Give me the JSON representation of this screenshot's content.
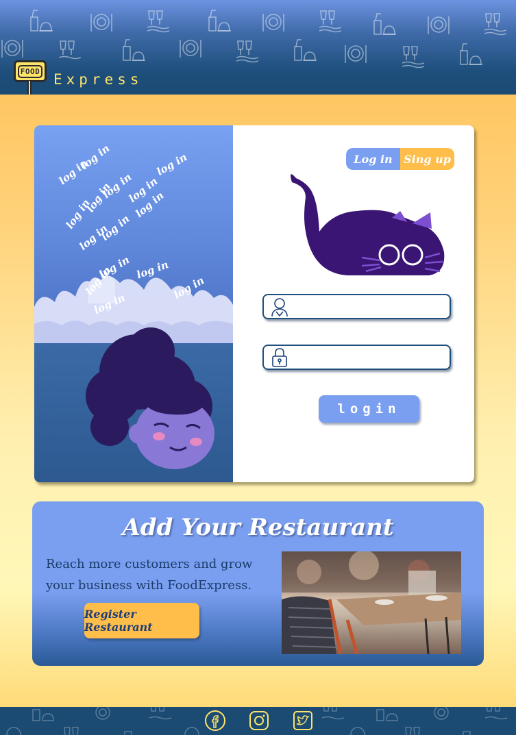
{
  "header": {
    "logo_sign": "FOOD",
    "brand": "Express",
    "accent": "#ffe46a",
    "background": "#1e4f7c"
  },
  "login": {
    "illustration_words": "log in",
    "tabs": [
      {
        "label": "Log in",
        "color": "#7b9ff0",
        "active": true
      },
      {
        "label": "Sing up",
        "color": "#ffbd4a",
        "active": false
      }
    ],
    "username": {
      "value": "",
      "placeholder": "",
      "icon": "user-icon"
    },
    "password": {
      "value": "",
      "placeholder": "",
      "icon": "lock-icon"
    },
    "submit_label": "login"
  },
  "restaurant": {
    "title": "Add Your Restaurant",
    "description": "Reach more customers and grow your business with FoodExpress.",
    "button_label": "Register Restaurant"
  },
  "footer": {
    "social": [
      {
        "name": "facebook-icon"
      },
      {
        "name": "instagram-icon"
      },
      {
        "name": "twitter-icon"
      }
    ]
  }
}
